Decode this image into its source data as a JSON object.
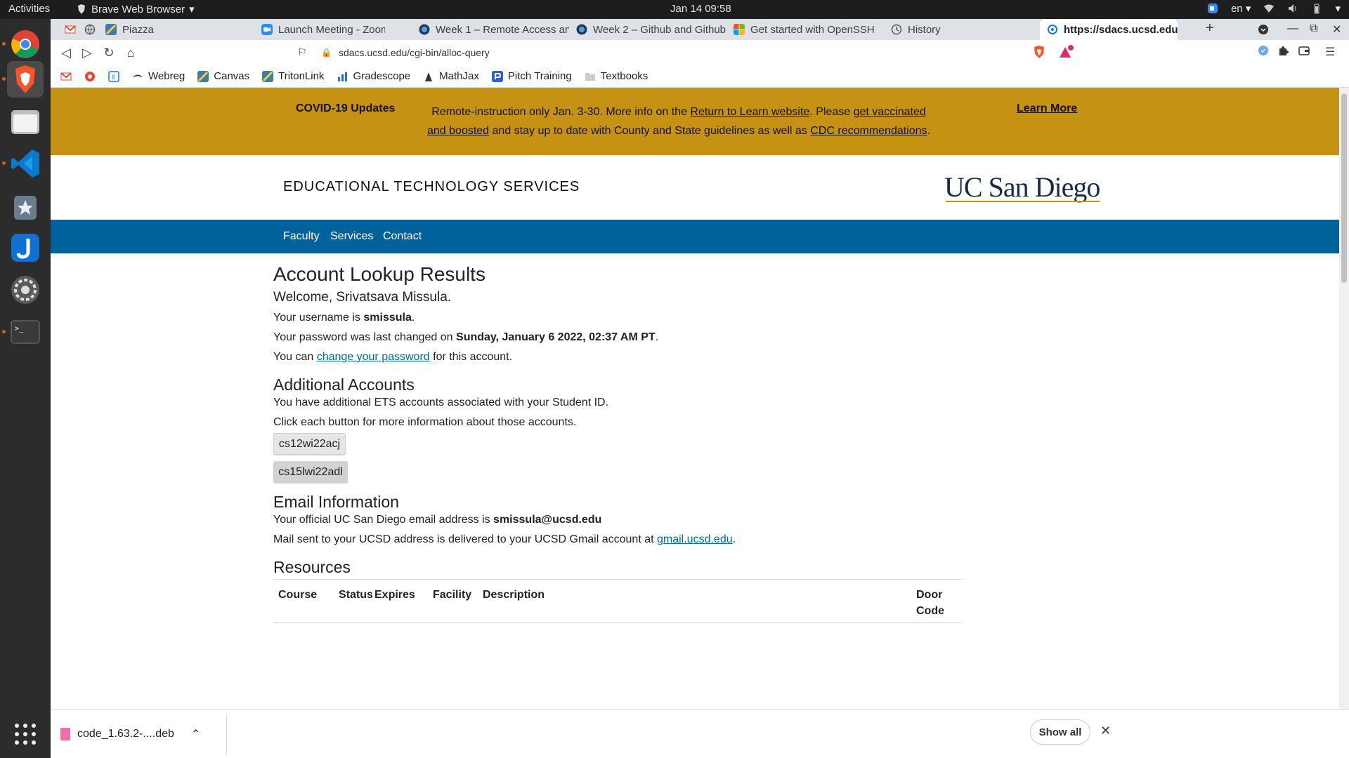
{
  "topbar": {
    "activities": "Activities",
    "app_name": "Brave Web Browser",
    "clock": "Jan 14  09:58",
    "lang": "en"
  },
  "dock": {
    "items": [
      "chrome-icon",
      "brave-icon",
      "files-icon",
      "vscode-icon",
      "software-icon",
      "joplin-icon",
      "settings-icon",
      "terminal-icon",
      "app-grid-icon"
    ]
  },
  "tabs": [
    {
      "label": "",
      "icon": "gmail-icon"
    },
    {
      "label": "",
      "icon": "globe-icon"
    },
    {
      "label": "Piazza",
      "icon": "piazza-icon"
    },
    {
      "label": "Launch Meeting - Zoom",
      "icon": "zoom-icon"
    },
    {
      "label": "Week 1 – Remote Access an",
      "icon": "github-icon"
    },
    {
      "label": "Week 2 – Github and Github",
      "icon": "github-icon"
    },
    {
      "label": "Get started with OpenSSH",
      "icon": "microsoft-icon"
    },
    {
      "label": "History",
      "icon": "history-icon"
    },
    {
      "label": "https://sdacs.ucsd.edu/",
      "icon": "site-icon"
    }
  ],
  "address": {
    "url": "sdacs.ucsd.edu/cgi-bin/alloc-query"
  },
  "bookmarks": [
    {
      "label": "",
      "icon": "gmail-icon"
    },
    {
      "label": "",
      "icon": "google-icon"
    },
    {
      "label": "",
      "icon": "calendar-icon"
    },
    {
      "label": "Webreg",
      "icon": "webreg-icon"
    },
    {
      "label": "Canvas",
      "icon": "canvas-icon"
    },
    {
      "label": "TritonLink",
      "icon": "tritonlink-icon"
    },
    {
      "label": "Gradescope",
      "icon": "gradescope-icon"
    },
    {
      "label": "MathJax",
      "icon": "mathjax-icon"
    },
    {
      "label": "Pitch Training",
      "icon": "pitch-icon"
    },
    {
      "label": "Textbooks",
      "icon": "folder-icon"
    }
  ],
  "covid": {
    "title": "COVID-19 Updates",
    "t1": "Remote-instruction only Jan. 3-30. More info on the ",
    "link1": "Return to Learn website",
    "t2": ". Please ",
    "link2": "get vaccinated and boosted",
    "t3": " and stay up to date with County and State guidelines as well as ",
    "link3": "CDC recommendations",
    "t4": ".",
    "learn_more": "Learn More"
  },
  "header": {
    "title": "EDUCATIONAL TECHNOLOGY SERVICES",
    "logo": "UC San Diego"
  },
  "nav": [
    "Faculty",
    "Services",
    "Contact"
  ],
  "content": {
    "h1": "Account Lookup Results",
    "welcome": "Welcome, Srivatsava Missula.",
    "username_pre": "Your username is ",
    "username": "smissula",
    "username_post": ".",
    "pw_pre": "Your password was last changed on ",
    "pw_date": "Sunday, January 6 2022, 02:37 AM PT",
    "pw_post": ".",
    "change_pre": "You can ",
    "change_link": "change your password",
    "change_post": " for this account.",
    "h2_additional": "Additional Accounts",
    "additional_1": "You have additional ETS accounts associated with your Student ID.",
    "additional_2": "Click each button for more information about those accounts.",
    "accounts": [
      "cs12wi22acj",
      "cs15lwi22adl"
    ],
    "h2_email": "Email Information",
    "email_pre": "Your official UC San Diego email address is ",
    "email": "smissula@ucsd.edu",
    "mail_pre": "Mail sent to your UCSD address is delivered to your UCSD Gmail account at ",
    "mail_link": "gmail.ucsd.edu",
    "mail_post": ".",
    "h2_resources": "Resources",
    "table_headers": [
      "Course",
      "Status",
      "Expires",
      "Facility",
      "Description",
      "Door Code"
    ]
  },
  "downloads": {
    "file": "code_1.63.2-....deb",
    "show_all": "Show all"
  }
}
